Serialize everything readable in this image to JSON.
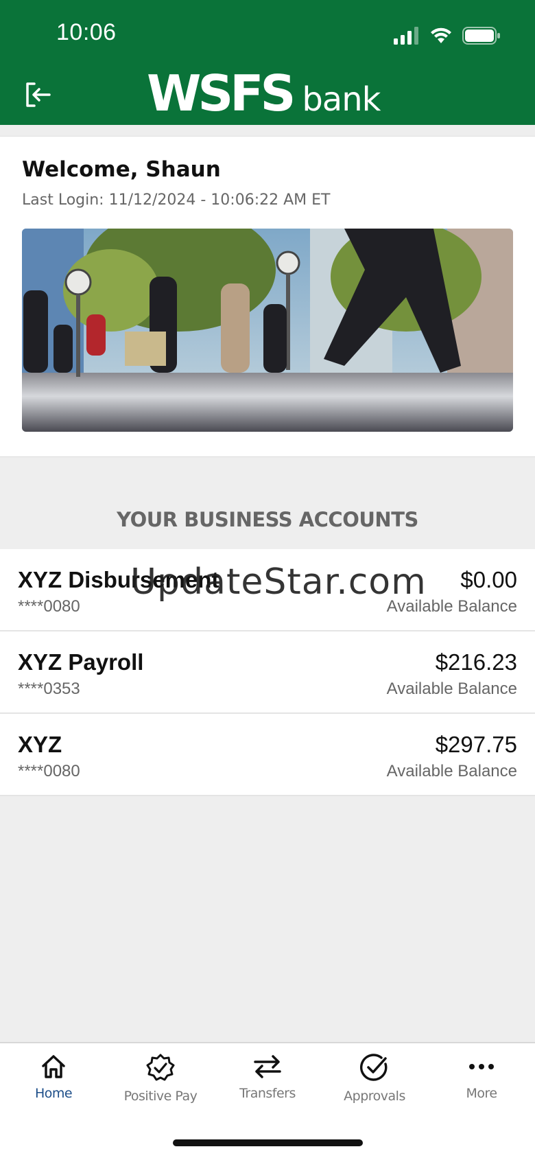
{
  "status_bar": {
    "time": "10:06"
  },
  "header": {
    "logo_main": "WSFS",
    "logo_sub": "bank"
  },
  "welcome": {
    "title": "Welcome, Shaun",
    "last_login": "Last Login: 11/12/2024 - 10:06:22 AM ET"
  },
  "accounts_section": {
    "title": "YOUR BUSINESS ACCOUNTS",
    "accounts": [
      {
        "name": "XYZ Disbursement",
        "number": "****0080",
        "balance": "$0.00",
        "balance_label": "Available Balance"
      },
      {
        "name": "XYZ Payroll",
        "number": "****0353",
        "balance": "$216.23",
        "balance_label": "Available Balance"
      },
      {
        "name": "XYZ",
        "number": "****0080",
        "balance": "$297.75",
        "balance_label": "Available Balance"
      }
    ]
  },
  "watermark": "UpdateStar.com",
  "tabs": [
    {
      "label": "Home",
      "icon": "home-icon",
      "active": true
    },
    {
      "label": "Positive Pay",
      "icon": "badge-check-icon"
    },
    {
      "label": "Transfers",
      "icon": "transfer-arrows-icon"
    },
    {
      "label": "Approvals",
      "icon": "circle-check-icon"
    },
    {
      "label": "More",
      "icon": "more-dots-icon"
    }
  ],
  "colors": {
    "brand_green": "#0a7339",
    "active_tab": "#1d4e89"
  }
}
